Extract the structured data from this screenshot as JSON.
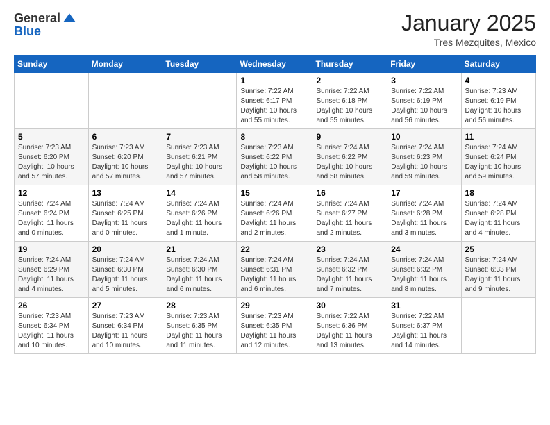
{
  "logo": {
    "general": "General",
    "blue": "Blue"
  },
  "header": {
    "title": "January 2025",
    "subtitle": "Tres Mezquites, Mexico"
  },
  "weekdays": [
    "Sunday",
    "Monday",
    "Tuesday",
    "Wednesday",
    "Thursday",
    "Friday",
    "Saturday"
  ],
  "weeks": [
    [
      {
        "day": "",
        "info": ""
      },
      {
        "day": "",
        "info": ""
      },
      {
        "day": "",
        "info": ""
      },
      {
        "day": "1",
        "info": "Sunrise: 7:22 AM\nSunset: 6:17 PM\nDaylight: 10 hours\nand 55 minutes."
      },
      {
        "day": "2",
        "info": "Sunrise: 7:22 AM\nSunset: 6:18 PM\nDaylight: 10 hours\nand 55 minutes."
      },
      {
        "day": "3",
        "info": "Sunrise: 7:22 AM\nSunset: 6:19 PM\nDaylight: 10 hours\nand 56 minutes."
      },
      {
        "day": "4",
        "info": "Sunrise: 7:23 AM\nSunset: 6:19 PM\nDaylight: 10 hours\nand 56 minutes."
      }
    ],
    [
      {
        "day": "5",
        "info": "Sunrise: 7:23 AM\nSunset: 6:20 PM\nDaylight: 10 hours\nand 57 minutes."
      },
      {
        "day": "6",
        "info": "Sunrise: 7:23 AM\nSunset: 6:20 PM\nDaylight: 10 hours\nand 57 minutes."
      },
      {
        "day": "7",
        "info": "Sunrise: 7:23 AM\nSunset: 6:21 PM\nDaylight: 10 hours\nand 57 minutes."
      },
      {
        "day": "8",
        "info": "Sunrise: 7:23 AM\nSunset: 6:22 PM\nDaylight: 10 hours\nand 58 minutes."
      },
      {
        "day": "9",
        "info": "Sunrise: 7:24 AM\nSunset: 6:22 PM\nDaylight: 10 hours\nand 58 minutes."
      },
      {
        "day": "10",
        "info": "Sunrise: 7:24 AM\nSunset: 6:23 PM\nDaylight: 10 hours\nand 59 minutes."
      },
      {
        "day": "11",
        "info": "Sunrise: 7:24 AM\nSunset: 6:24 PM\nDaylight: 10 hours\nand 59 minutes."
      }
    ],
    [
      {
        "day": "12",
        "info": "Sunrise: 7:24 AM\nSunset: 6:24 PM\nDaylight: 11 hours\nand 0 minutes."
      },
      {
        "day": "13",
        "info": "Sunrise: 7:24 AM\nSunset: 6:25 PM\nDaylight: 11 hours\nand 0 minutes."
      },
      {
        "day": "14",
        "info": "Sunrise: 7:24 AM\nSunset: 6:26 PM\nDaylight: 11 hours\nand 1 minute."
      },
      {
        "day": "15",
        "info": "Sunrise: 7:24 AM\nSunset: 6:26 PM\nDaylight: 11 hours\nand 2 minutes."
      },
      {
        "day": "16",
        "info": "Sunrise: 7:24 AM\nSunset: 6:27 PM\nDaylight: 11 hours\nand 2 minutes."
      },
      {
        "day": "17",
        "info": "Sunrise: 7:24 AM\nSunset: 6:28 PM\nDaylight: 11 hours\nand 3 minutes."
      },
      {
        "day": "18",
        "info": "Sunrise: 7:24 AM\nSunset: 6:28 PM\nDaylight: 11 hours\nand 4 minutes."
      }
    ],
    [
      {
        "day": "19",
        "info": "Sunrise: 7:24 AM\nSunset: 6:29 PM\nDaylight: 11 hours\nand 4 minutes."
      },
      {
        "day": "20",
        "info": "Sunrise: 7:24 AM\nSunset: 6:30 PM\nDaylight: 11 hours\nand 5 minutes."
      },
      {
        "day": "21",
        "info": "Sunrise: 7:24 AM\nSunset: 6:30 PM\nDaylight: 11 hours\nand 6 minutes."
      },
      {
        "day": "22",
        "info": "Sunrise: 7:24 AM\nSunset: 6:31 PM\nDaylight: 11 hours\nand 6 minutes."
      },
      {
        "day": "23",
        "info": "Sunrise: 7:24 AM\nSunset: 6:32 PM\nDaylight: 11 hours\nand 7 minutes."
      },
      {
        "day": "24",
        "info": "Sunrise: 7:24 AM\nSunset: 6:32 PM\nDaylight: 11 hours\nand 8 minutes."
      },
      {
        "day": "25",
        "info": "Sunrise: 7:24 AM\nSunset: 6:33 PM\nDaylight: 11 hours\nand 9 minutes."
      }
    ],
    [
      {
        "day": "26",
        "info": "Sunrise: 7:23 AM\nSunset: 6:34 PM\nDaylight: 11 hours\nand 10 minutes."
      },
      {
        "day": "27",
        "info": "Sunrise: 7:23 AM\nSunset: 6:34 PM\nDaylight: 11 hours\nand 10 minutes."
      },
      {
        "day": "28",
        "info": "Sunrise: 7:23 AM\nSunset: 6:35 PM\nDaylight: 11 hours\nand 11 minutes."
      },
      {
        "day": "29",
        "info": "Sunrise: 7:23 AM\nSunset: 6:35 PM\nDaylight: 11 hours\nand 12 minutes."
      },
      {
        "day": "30",
        "info": "Sunrise: 7:22 AM\nSunset: 6:36 PM\nDaylight: 11 hours\nand 13 minutes."
      },
      {
        "day": "31",
        "info": "Sunrise: 7:22 AM\nSunset: 6:37 PM\nDaylight: 11 hours\nand 14 minutes."
      },
      {
        "day": "",
        "info": ""
      }
    ]
  ]
}
